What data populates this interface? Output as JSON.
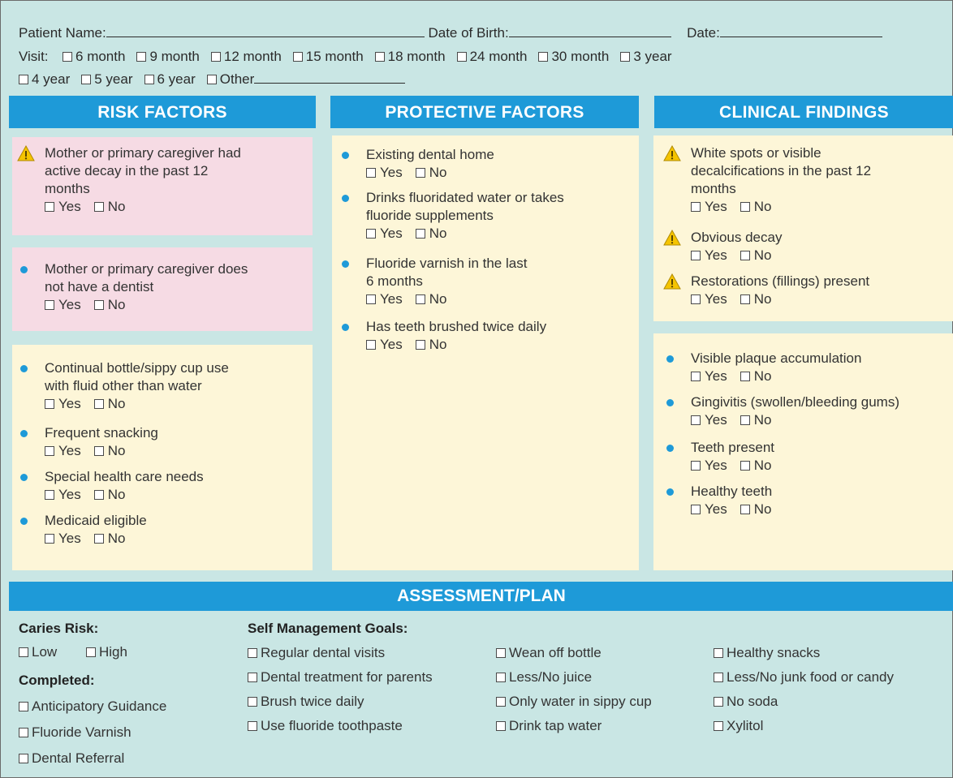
{
  "header": {
    "patient_name_label": "Patient Name:",
    "dob_label": "Date of Birth:",
    "date_label": "Date:",
    "visit_label": "Visit:",
    "visit_options_row1": [
      "6 month",
      "9 month",
      "12 month",
      "15 month",
      "18 month",
      "24 month",
      "30 month",
      "3 year"
    ],
    "visit_options_row2": [
      "4 year",
      "5 year",
      "6 year",
      "Other"
    ]
  },
  "columns": {
    "risk": "RISK FACTORS",
    "protective": "PROTECTIVE FACTORS",
    "clinical": "CLINICAL FINDINGS"
  },
  "yes_label": "Yes",
  "no_label": "No",
  "risk_items": [
    {
      "icon": "warning-icon",
      "lines": [
        "Mother or primary caregiver had",
        "active decay in the past 12",
        "months"
      ]
    },
    {
      "icon": "bullet-icon",
      "lines": [
        "Mother or primary caregiver does",
        "not have a dentist"
      ]
    },
    {
      "icon": "bullet-icon",
      "lines": [
        "Continual bottle/sippy cup use",
        "with fluid other than water"
      ]
    },
    {
      "icon": "bullet-icon",
      "lines": [
        "Frequent snacking"
      ]
    },
    {
      "icon": "bullet-icon",
      "lines": [
        "Special health care needs"
      ]
    },
    {
      "icon": "bullet-icon",
      "lines": [
        "Medicaid eligible"
      ]
    }
  ],
  "protective_items": [
    {
      "icon": "bullet-icon",
      "lines": [
        "Existing dental home"
      ]
    },
    {
      "icon": "bullet-icon",
      "lines": [
        "Drinks fluoridated water or takes",
        "fluoride supplements"
      ]
    },
    {
      "icon": "bullet-icon",
      "lines": [
        "Fluoride varnish in the last",
        "6 months"
      ]
    },
    {
      "icon": "bullet-icon",
      "lines": [
        "Has teeth brushed twice daily"
      ]
    }
  ],
  "clinical_items": [
    {
      "icon": "warning-icon",
      "lines": [
        "White spots or visible",
        "decalcifications in the past 12",
        "months"
      ]
    },
    {
      "icon": "warning-icon",
      "lines": [
        "Obvious decay"
      ]
    },
    {
      "icon": "warning-icon",
      "lines": [
        "Restorations (fillings) present"
      ]
    },
    {
      "icon": "bullet-icon",
      "lines": [
        "Visible plaque accumulation"
      ]
    },
    {
      "icon": "bullet-icon",
      "lines": [
        "Gingivitis (swollen/bleeding gums)"
      ]
    },
    {
      "icon": "bullet-icon",
      "lines": [
        "Teeth present"
      ]
    },
    {
      "icon": "bullet-icon",
      "lines": [
        "Healthy teeth"
      ]
    }
  ],
  "assessment": {
    "title": "ASSESSMENT/PLAN",
    "caries_risk_label": "Caries Risk:",
    "caries_low": "Low",
    "caries_high": "High",
    "completed_label": "Completed:",
    "completed_options": [
      "Anticipatory Guidance",
      "Fluoride Varnish",
      "Dental Referral"
    ],
    "goals_label": "Self Management Goals:",
    "goals_col1": [
      "Regular dental visits",
      "Dental treatment for parents",
      "Brush twice daily",
      "Use fluoride toothpaste"
    ],
    "goals_col2": [
      "Wean off bottle",
      "Less/No juice",
      "Only water in sippy cup",
      "Drink tap water"
    ],
    "goals_col3": [
      "Healthy snacks",
      "Less/No junk food or candy",
      "No soda",
      "Xylitol"
    ]
  },
  "colors": {
    "background": "#c9e6e4",
    "header_blue": "#1e9ad8",
    "pink_panel": "#f6dbe4",
    "yellow_panel": "#fdf6d8",
    "warning_yellow": "#f5c400"
  }
}
